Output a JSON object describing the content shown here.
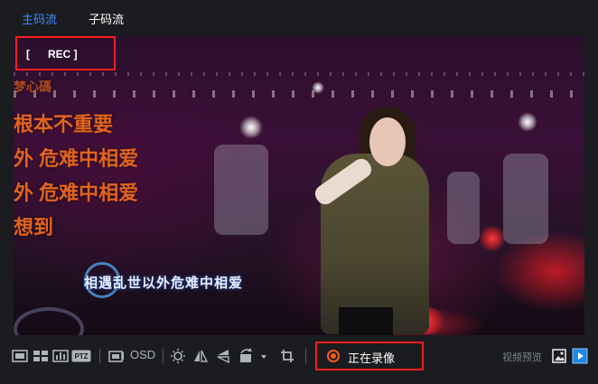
{
  "tabs": [
    {
      "label": "主码流",
      "active": true
    },
    {
      "label": "子码流",
      "active": false
    }
  ],
  "video": {
    "rec_badge": "[      REC ]",
    "side_lyrics": [
      "梦心碼",
      "根本不重要",
      "外 危难中相爱",
      "外 危难中相爱",
      "想到"
    ],
    "subtitle": "相遇乱世以外危难中相爱"
  },
  "toolbar": {
    "osd_label": "OSD",
    "ptz_label": "PTZ",
    "recording_label": "正在录像",
    "preview_label": "视频预览"
  },
  "colors": {
    "accent": "#3d8bff",
    "highlight_border": "#ff1e1e",
    "record_indicator": "#ff5a1e"
  },
  "icons": [
    "grid-1x1-icon",
    "grid-2x2-icon",
    "bar-chart-icon",
    "ptz-icon",
    "snapshot-icon",
    "brightness-icon",
    "mirror-icon",
    "flip-icon",
    "rotate-icon",
    "crop-icon",
    "record-icon",
    "image-icon",
    "play-icon"
  ]
}
